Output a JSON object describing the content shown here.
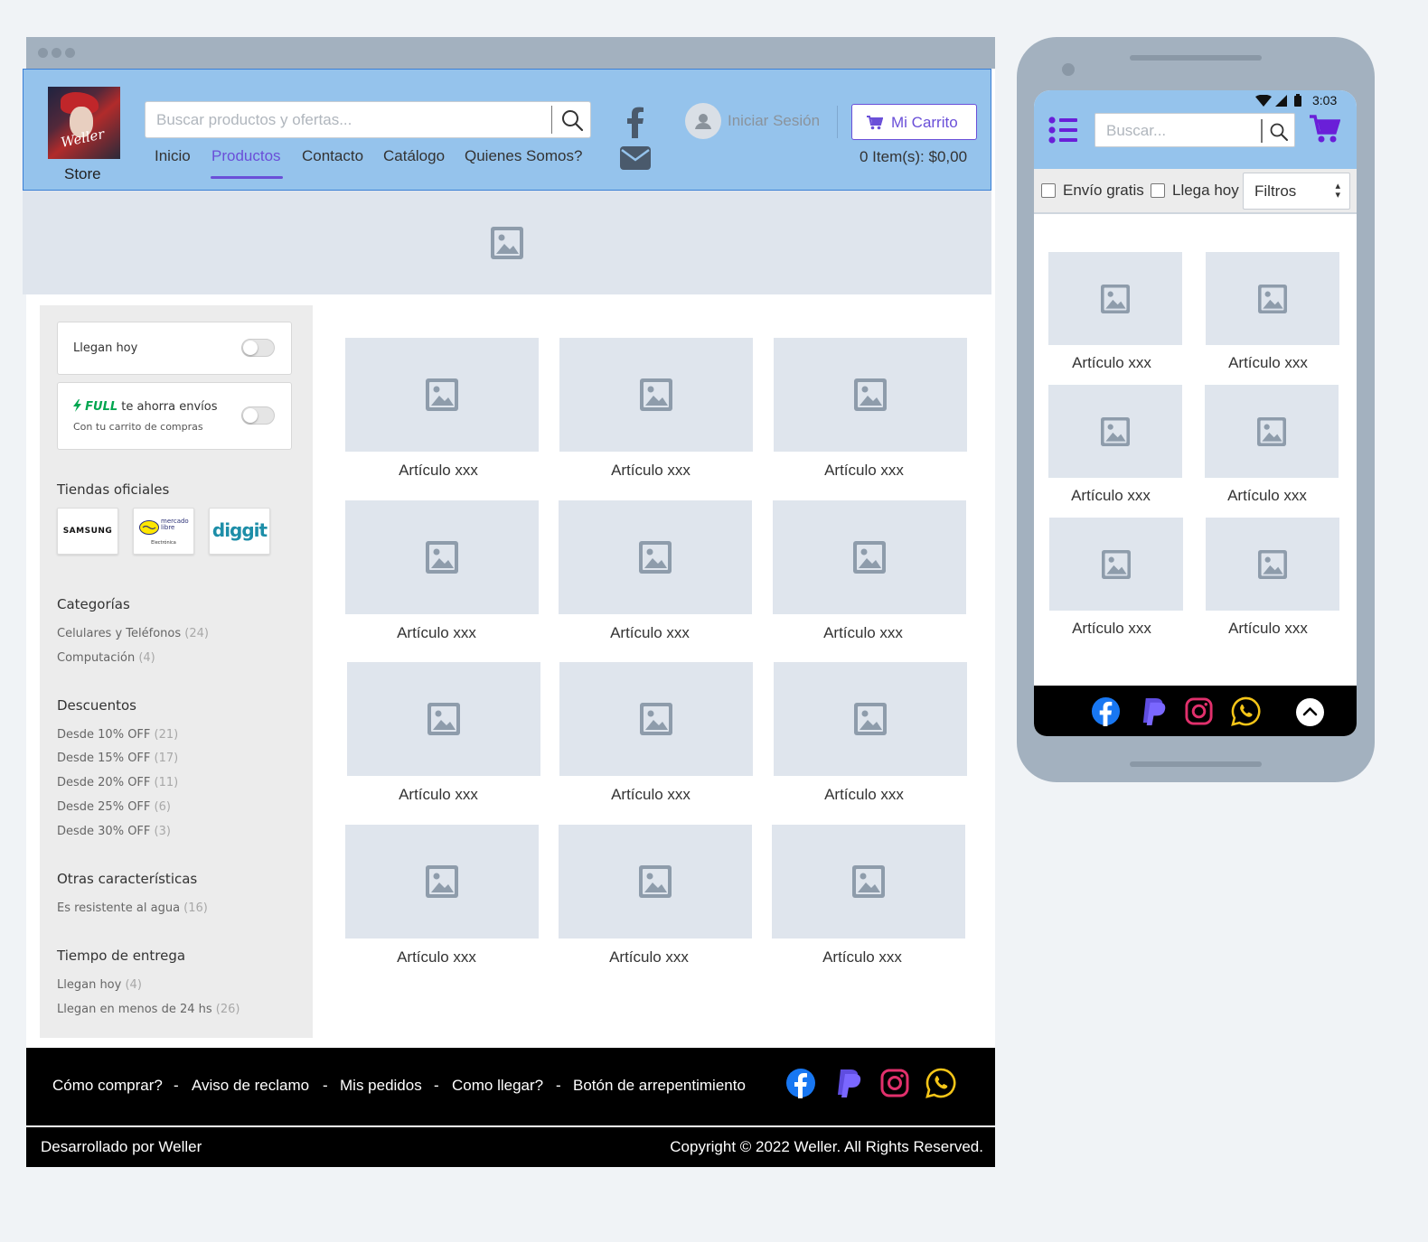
{
  "desktop": {
    "header": {
      "store_label": "Store",
      "logo_signature": "Weller",
      "search_placeholder": "Buscar productos y ofertas...",
      "nav": [
        "Inicio",
        "Productos",
        "Contacto",
        "Catálogo",
        "Quienes Somos?"
      ],
      "active_nav": "Productos",
      "login_label": "Iniciar Sesión",
      "cart_label": "Mi Carrito",
      "cart_count": "0 Item(s): $0,00"
    },
    "sidebar": {
      "toggle_today": "Llegan hoy",
      "full_brand": "FULL",
      "full_text": "te ahorra envíos",
      "full_sub": "Con tu carrito de compras",
      "stores_title": "Tiendas oficiales",
      "stores": [
        "SAMSUNG",
        "mercado libre",
        "Electrónica",
        "diggit"
      ],
      "sections": [
        {
          "title": "Categorías",
          "items": [
            {
              "label": "Celulares y Teléfonos",
              "count": "(24)"
            },
            {
              "label": "Computación",
              "count": "(4)"
            }
          ]
        },
        {
          "title": "Descuentos",
          "items": [
            {
              "label": "Desde 10% OFF",
              "count": "(21)"
            },
            {
              "label": "Desde 15% OFF",
              "count": "(17)"
            },
            {
              "label": "Desde 20% OFF",
              "count": "(11)"
            },
            {
              "label": "Desde 25% OFF",
              "count": "(6)"
            },
            {
              "label": "Desde 30% OFF",
              "count": "(3)"
            }
          ]
        },
        {
          "title": "Otras características",
          "items": [
            {
              "label": "Es resistente al agua",
              "count": "(16)"
            }
          ]
        },
        {
          "title": "Tiempo de entrega",
          "items": [
            {
              "label": "Llegan hoy",
              "count": "(4)"
            },
            {
              "label": "Llegan en menos de 24 hs",
              "count": "(26)"
            }
          ]
        }
      ]
    },
    "products": [
      "Artículo xxx",
      "Artículo xxx",
      "Artículo xxx",
      "Artículo xxx",
      "Artículo xxx",
      "Artículo xxx",
      "Artículo xxx",
      "Artículo xxx",
      "Artículo xxx",
      "Artículo xxx",
      "Artículo xxx",
      "Artículo xxx"
    ],
    "footer": {
      "links": [
        "Cómo comprar?",
        "Aviso de reclamo",
        "Mis pedidos",
        "Como llegar?",
        "Botón de arrepentimiento"
      ],
      "separator": "-",
      "developed_by": "Desarrollado por Weller",
      "copyright": "Copyright © 2022 Weller.  All Rights Reserved."
    }
  },
  "mobile": {
    "time": "3:03",
    "search_placeholder": "Buscar...",
    "filter_free_shipping": "Envío gratis",
    "filter_arrives_today": "Llega hoy",
    "filters_select": "Filtros",
    "products": [
      "Artículo xxx",
      "Artículo xxx",
      "Artículo xxx",
      "Artículo xxx",
      "Artículo xxx",
      "Artículo xxx"
    ]
  },
  "colors": {
    "header_bg": "#95c3ec",
    "accent": "#6a4fd8",
    "placeholder_bg": "#dfe5ed",
    "footer_bg": "#000000",
    "full_green": "#00a650"
  },
  "icons": [
    "search-icon",
    "facebook-icon",
    "mail-icon",
    "user-icon",
    "cart-icon",
    "image-placeholder-icon",
    "paypal-icon",
    "instagram-icon",
    "whatsapp-icon",
    "menu-list-icon",
    "wifi-icon",
    "signal-icon",
    "battery-icon",
    "chevron-up-icon",
    "lightning-icon"
  ]
}
